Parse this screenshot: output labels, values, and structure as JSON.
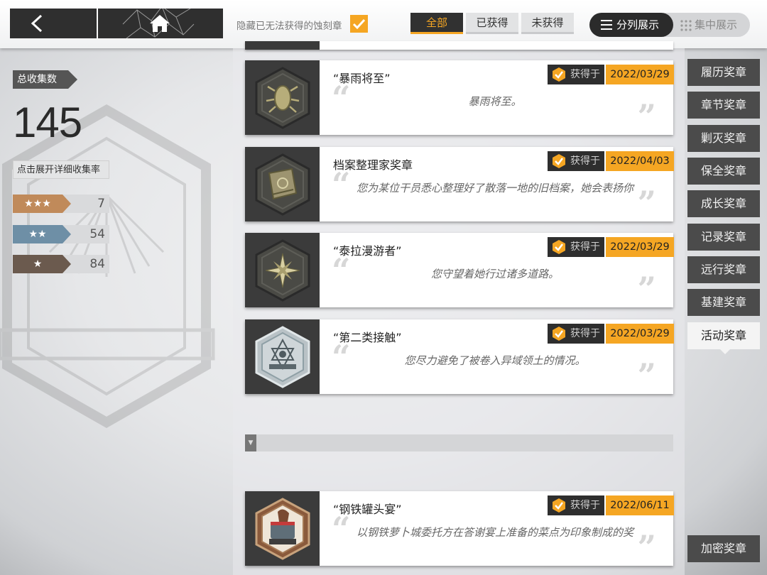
{
  "topbar": {
    "back_icon": "chevron-left-icon",
    "home_icon": "house-icon",
    "hide_unobtainable_label": "隐藏已无法获得的蚀刻章",
    "hide_unobtainable_checked": true,
    "filter_tabs": [
      "全部",
      "已获得",
      "未获得"
    ],
    "filter_active": "全部",
    "view_modes": [
      "分列展示",
      "集中展示"
    ],
    "view_active": "分列展示"
  },
  "stats": {
    "total_label": "总收集数",
    "total": "145",
    "detail_button": "点击展开详细收集率",
    "rarities": [
      {
        "stars": "★★★",
        "count": "7"
      },
      {
        "stars": "★★",
        "count": "54"
      },
      {
        "stars": "★",
        "count": "84"
      }
    ]
  },
  "medals": [
    {
      "name": "“暴雨将至”",
      "desc": "暴雨将至。",
      "got_label": "获得于",
      "date": "2022/03/29",
      "icon": "bug-emblem-icon"
    },
    {
      "name": "档案整理家奖章",
      "desc": "您为某位干员悉心整理好了散落一地的旧档案，她会表扬你",
      "got_label": "获得于",
      "date": "2022/04/03",
      "icon": "book-emblem-icon"
    },
    {
      "name": "“泰拉漫游者”",
      "desc": "您守望着她行过诸多道路。",
      "got_label": "获得于",
      "date": "2022/03/29",
      "icon": "compass-star-icon"
    },
    {
      "name": "“第二类接触”",
      "desc": "您尽力避免了被卷入异域领土的情况。",
      "got_label": "获得于",
      "date": "2022/03/29",
      "icon": "holographic-emblem-icon"
    },
    {
      "name": "“钢铁罐头宴”",
      "desc": "以钢铁萝卜城委托方在答谢宴上准备的菜点为印象制成的奖",
      "got_label": "获得于",
      "date": "2022/06/11",
      "icon": "banquet-emblem-icon"
    }
  ],
  "categories": [
    "履历奖章",
    "章节奖章",
    "剿灭奖章",
    "保全奖章",
    "成长奖章",
    "记录奖章",
    "远行奖章",
    "基建奖章",
    "活动奖章"
  ],
  "category_active": "活动奖章",
  "encrypted_tab": "加密奖章",
  "colors": {
    "accent": "#f5a623",
    "dark": "#2f2f2f"
  }
}
